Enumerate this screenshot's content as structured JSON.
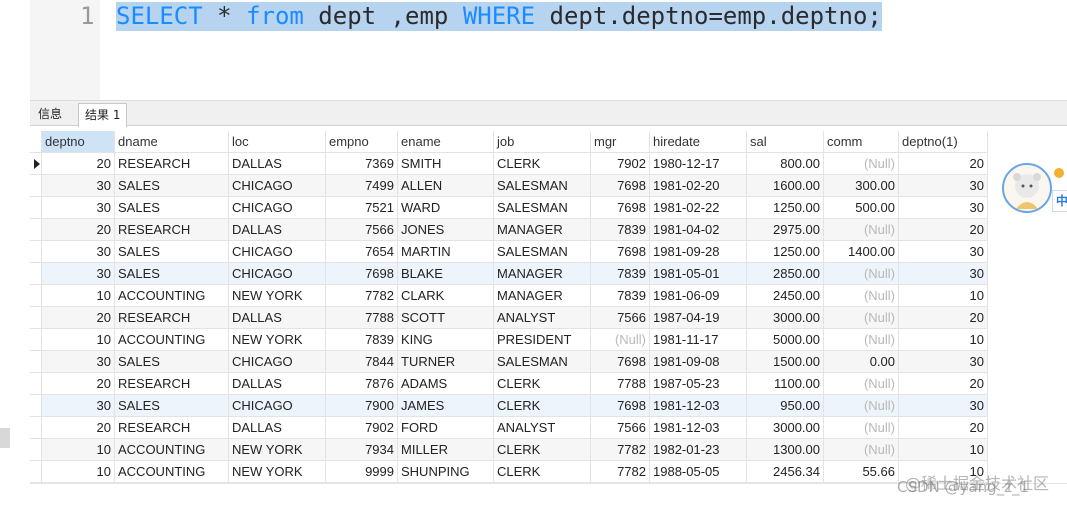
{
  "editor": {
    "line_number": "1",
    "tokens": [
      {
        "text": "SELECT",
        "kw": true
      },
      {
        "text": " * ",
        "kw": false
      },
      {
        "text": "from",
        "kw": true
      },
      {
        "text": " dept ,emp ",
        "kw": false
      },
      {
        "text": "WHERE",
        "kw": true
      },
      {
        "text": " dept.deptno=emp.deptno;",
        "kw": false
      }
    ]
  },
  "tabs": {
    "info": "信息",
    "result": "结果 1"
  },
  "grid": {
    "columns": [
      {
        "key": "deptno",
        "label": "deptno",
        "num": true
      },
      {
        "key": "dname",
        "label": "dname",
        "num": false
      },
      {
        "key": "loc",
        "label": "loc",
        "num": false
      },
      {
        "key": "empno",
        "label": "empno",
        "num": true
      },
      {
        "key": "ename",
        "label": "ename",
        "num": false
      },
      {
        "key": "job",
        "label": "job",
        "num": false
      },
      {
        "key": "mgr",
        "label": "mgr",
        "num": true
      },
      {
        "key": "hiredate",
        "label": "hiredate",
        "num": false
      },
      {
        "key": "sal",
        "label": "sal",
        "num": true
      },
      {
        "key": "comm",
        "label": "comm",
        "num": true
      },
      {
        "key": "deptno1",
        "label": "deptno(1)",
        "num": true
      }
    ],
    "null_text": "(Null)",
    "rows": [
      [
        "20",
        "RESEARCH",
        "DALLAS",
        "7369",
        "SMITH",
        "CLERK",
        "7902",
        "1980-12-17",
        "800.00",
        null,
        "20"
      ],
      [
        "30",
        "SALES",
        "CHICAGO",
        "7499",
        "ALLEN",
        "SALESMAN",
        "7698",
        "1981-02-20",
        "1600.00",
        "300.00",
        "30"
      ],
      [
        "30",
        "SALES",
        "CHICAGO",
        "7521",
        "WARD",
        "SALESMAN",
        "7698",
        "1981-02-22",
        "1250.00",
        "500.00",
        "30"
      ],
      [
        "20",
        "RESEARCH",
        "DALLAS",
        "7566",
        "JONES",
        "MANAGER",
        "7839",
        "1981-04-02",
        "2975.00",
        null,
        "20"
      ],
      [
        "30",
        "SALES",
        "CHICAGO",
        "7654",
        "MARTIN",
        "SALESMAN",
        "7698",
        "1981-09-28",
        "1250.00",
        "1400.00",
        "30"
      ],
      [
        "30",
        "SALES",
        "CHICAGO",
        "7698",
        "BLAKE",
        "MANAGER",
        "7839",
        "1981-05-01",
        "2850.00",
        null,
        "30"
      ],
      [
        "10",
        "ACCOUNTING",
        "NEW YORK",
        "7782",
        "CLARK",
        "MANAGER",
        "7839",
        "1981-06-09",
        "2450.00",
        null,
        "10"
      ],
      [
        "20",
        "RESEARCH",
        "DALLAS",
        "7788",
        "SCOTT",
        "ANALYST",
        "7566",
        "1987-04-19",
        "3000.00",
        null,
        "20"
      ],
      [
        "10",
        "ACCOUNTING",
        "NEW YORK",
        "7839",
        "KING",
        "PRESIDENT",
        null,
        "1981-11-17",
        "5000.00",
        null,
        "10"
      ],
      [
        "30",
        "SALES",
        "CHICAGO",
        "7844",
        "TURNER",
        "SALESMAN",
        "7698",
        "1981-09-08",
        "1500.00",
        "0.00",
        "30"
      ],
      [
        "20",
        "RESEARCH",
        "DALLAS",
        "7876",
        "ADAMS",
        "CLERK",
        "7788",
        "1987-05-23",
        "1100.00",
        null,
        "20"
      ],
      [
        "30",
        "SALES",
        "CHICAGO",
        "7900",
        "JAMES",
        "CLERK",
        "7698",
        "1981-12-03",
        "950.00",
        null,
        "30"
      ],
      [
        "20",
        "RESEARCH",
        "DALLAS",
        "7902",
        "FORD",
        "ANALYST",
        "7566",
        "1981-12-03",
        "3000.00",
        null,
        "20"
      ],
      [
        "10",
        "ACCOUNTING",
        "NEW YORK",
        "7934",
        "MILLER",
        "CLERK",
        "7782",
        "1982-01-23",
        "1300.00",
        null,
        "10"
      ],
      [
        "10",
        "ACCOUNTING",
        "NEW YORK",
        "9999",
        "SHUNPING",
        "CLERK",
        "7782",
        "1988-05-05",
        "2456.34",
        "55.66",
        "10"
      ]
    ]
  },
  "avatar": {
    "badge": "中",
    "icon": "avatar-girl-icon"
  },
  "watermark": {
    "line1": "@稀土掘金技术社区",
    "line2": "CSDN @yang_z_1"
  }
}
